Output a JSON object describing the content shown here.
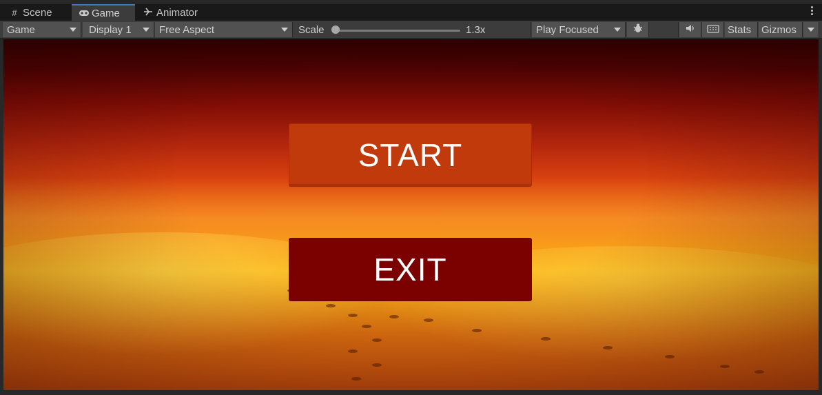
{
  "tabs": [
    {
      "label": "Scene",
      "icon": "grid-icon"
    },
    {
      "label": "Game",
      "icon": "gamepad-icon",
      "active": true
    },
    {
      "label": "Animator",
      "icon": "animator-icon"
    }
  ],
  "toolbar": {
    "view_select": "Game",
    "display_select": "Display 1",
    "aspect_select": "Free Aspect",
    "scale_label": "Scale",
    "scale_value": "1.3x",
    "play_mode_select": "Play Focused",
    "stats_label": "Stats",
    "gizmos_label": "Gizmos"
  },
  "game": {
    "start_label": "START",
    "exit_label": "EXIT"
  },
  "colors": {
    "accent": "#3a79bb",
    "start_button": "#c03a0c",
    "exit_button": "#7b0000"
  }
}
